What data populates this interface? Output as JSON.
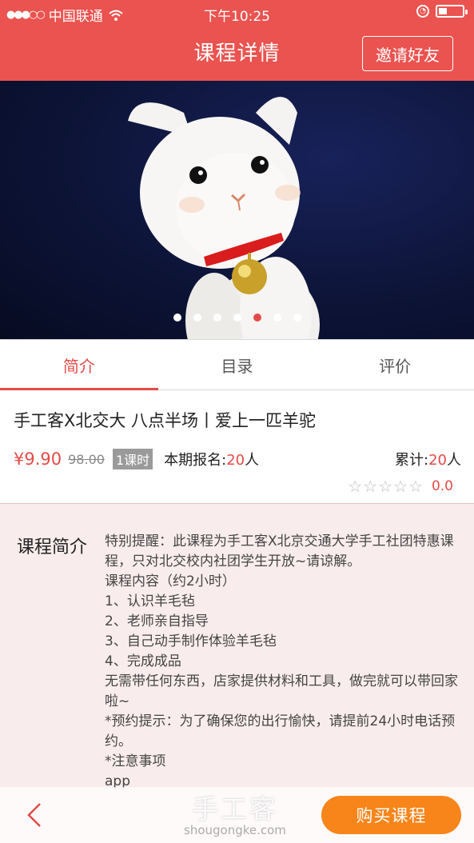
{
  "status_bar": {
    "carrier": "中国联通",
    "time": "下午10:25"
  },
  "header": {
    "title": "课程详情",
    "invite_label": "邀请好友"
  },
  "carousel": {
    "slide_count": 7,
    "active_index": 4
  },
  "tabs": [
    {
      "label": "简介",
      "active": true
    },
    {
      "label": "目录",
      "active": false
    },
    {
      "label": "评价",
      "active": false
    }
  ],
  "course": {
    "title": "手工客X北交大 八点半场丨爱上一匹羊驼",
    "price": "¥9.90",
    "original_price": "98.00",
    "badge": "1课时",
    "enroll_label": "本期报名:",
    "enroll_count": "20",
    "enroll_unit": "人",
    "total_label": "累计:",
    "total_count": "20",
    "total_unit": "人",
    "stars": "☆☆☆☆☆",
    "rating": "0.0"
  },
  "intro": {
    "label": "课程简介",
    "paragraphs": [
      "特别提醒：此课程为手工客X北京交通大学手工社团特惠课程，只对北交校内社团学生开放~请谅解。",
      "",
      "课程内容（约2小时）",
      "1、认识羊毛毡",
      "2、老师亲自指导",
      "3、自己动手制作体验羊毛毡",
      "4、完成成品",
      "无需带任何东西，店家提供材料和工具，做完就可以带回家啦~",
      "",
      "*预约提示：为了确保您的出行愉快，请提前24小时电话预约。",
      "*注意事项",
      "app"
    ]
  },
  "bottom": {
    "back_icon": "chevron-left-icon",
    "buy_label": "购买课程",
    "watermark_cn": "手工客",
    "watermark_en": "shougongke.com"
  },
  "colors": {
    "brand_red": "#ea5350",
    "accent_orange": "#f7851a",
    "intro_bg": "#f9ecec"
  }
}
